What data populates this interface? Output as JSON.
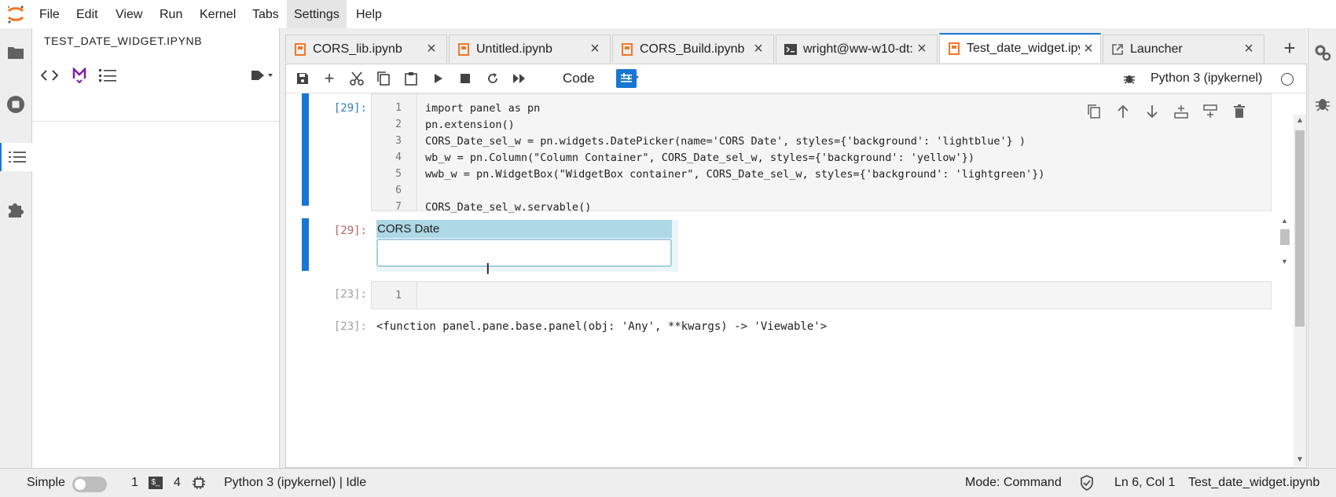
{
  "menubar": {
    "items": [
      "File",
      "Edit",
      "View",
      "Run",
      "Kernel",
      "Tabs",
      "Settings",
      "Help"
    ],
    "active": "Settings"
  },
  "left_panel": {
    "title": "TEST_DATE_WIDGET.IPYNB"
  },
  "tabs": [
    {
      "label": "CORS_lib.ipynb",
      "icon": "notebook-icon",
      "active": false
    },
    {
      "label": "Untitled.ipynb",
      "icon": "notebook-icon",
      "active": false
    },
    {
      "label": "CORS_Build.ipynb",
      "icon": "notebook-icon",
      "active": false
    },
    {
      "label": "wright@ww-w10-dt:",
      "icon": "terminal-icon",
      "active": false
    },
    {
      "label": "Test_date_widget.ipy",
      "icon": "notebook-icon",
      "active": true
    },
    {
      "label": "Launcher",
      "icon": "launch-icon",
      "active": false
    }
  ],
  "notebook_toolbar": {
    "cell_type": "Code",
    "kernel": "Python 3 (ipykernel)"
  },
  "cells": [
    {
      "prompt_in": "[29]:",
      "lines": [
        {
          "n": "1",
          "text": "import panel as pn"
        },
        {
          "n": "2",
          "text": "pn.extension()"
        },
        {
          "n": "3",
          "text": "CORS_Date_sel_w = pn.widgets.DatePicker(name='CORS Date', styles={'background': 'lightblue'} )"
        },
        {
          "n": "4",
          "text": "wb_w = pn.Column(\"Column Container\", CORS_Date_sel_w, styles={'background': 'yellow'})"
        },
        {
          "n": "5",
          "text": "wwb_w = pn.WidgetBox(\"WidgetBox container\", CORS_Date_sel_w, styles={'background': 'lightgreen'})"
        },
        {
          "n": "6",
          "text": ""
        },
        {
          "n": "7",
          "text": "CORS_Date_sel_w.servable()"
        }
      ],
      "prompt_out": "[29]:",
      "widget_label": "CORS Date",
      "widget_value": ""
    },
    {
      "prompt_in": "[23]:",
      "lines": [
        {
          "n": "1",
          "text": ""
        }
      ],
      "prompt_out": "[23]:",
      "output_text": "<function panel.pane.base.panel(obj: 'Any', **kwargs) -> 'Viewable'>"
    }
  ],
  "statusbar": {
    "simple_label": "Simple",
    "terminals_count": "1",
    "kernels_count": "4",
    "kernel_status": "Python 3 (ipykernel) | Idle",
    "mode": "Mode: Command",
    "cursor": "Ln 6, Col 1",
    "filename": "Test_date_widget.ipynb"
  },
  "colors": {
    "accent": "#1976d2",
    "jupyter_orange": "#f37726",
    "widget_bg": "#add8e6"
  }
}
